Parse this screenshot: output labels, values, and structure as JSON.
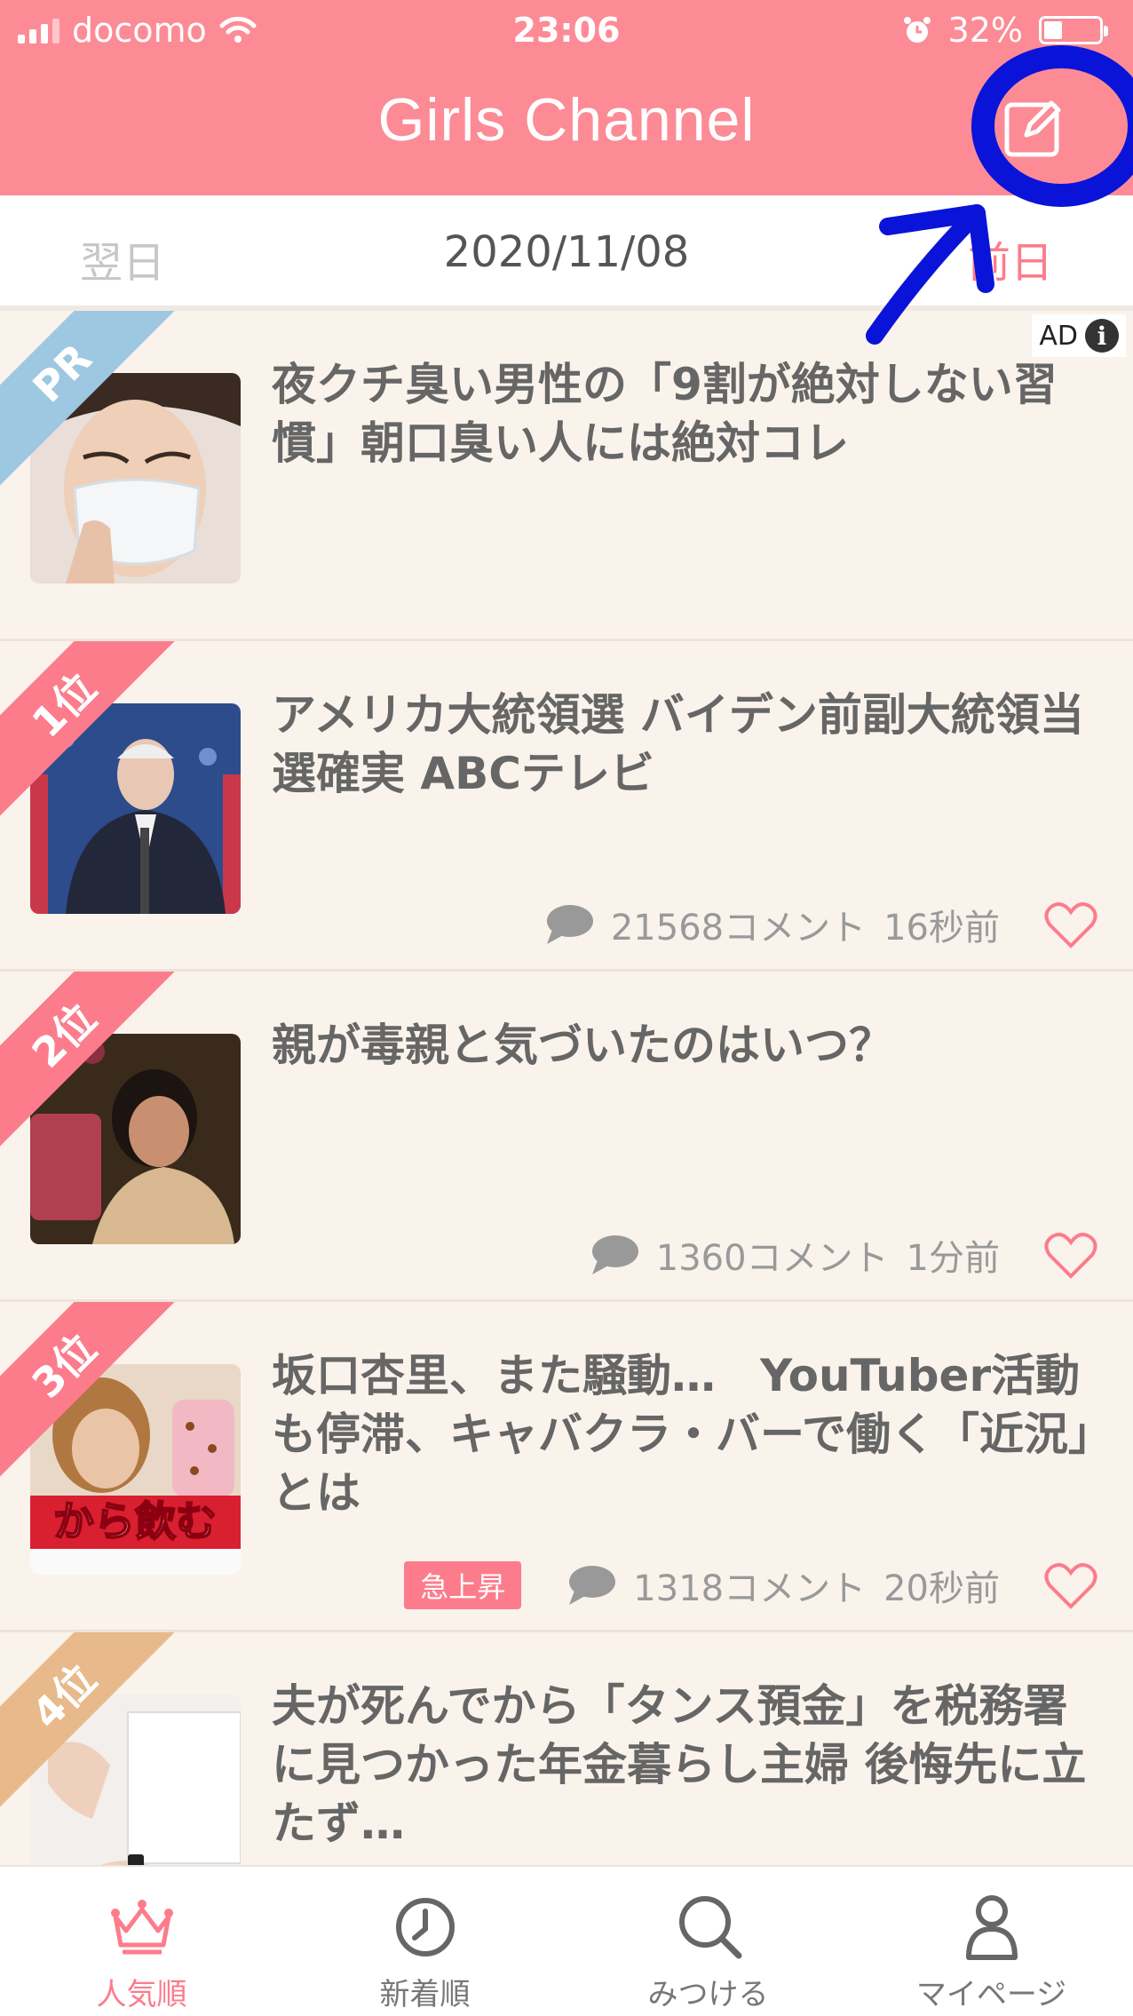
{
  "status_bar": {
    "carrier": "docomo",
    "time": "23:06",
    "battery": "32%"
  },
  "header": {
    "title": "Girls Channel"
  },
  "date_nav": {
    "next_label": "翌日",
    "date": "2020/11/08",
    "prev_label": "前日"
  },
  "ad_label": "AD",
  "items": [
    {
      "rank": "PR",
      "title": "夜クチ臭い男性の「9割が絶対しない習慣」朝口臭い人には絶対コレ"
    },
    {
      "rank": "1位",
      "title": "アメリカ大統領選 バイデン前副大統領当選確実 ABCテレビ",
      "comments": "21568コメント",
      "time": "16秒前"
    },
    {
      "rank": "2位",
      "title": "親が毒親と気づいたのはいつ？",
      "comments": "1360コメント",
      "time": "1分前"
    },
    {
      "rank": "3位",
      "title": "坂口杏里、また騒動…　YouTuber活動も停滞、キャバクラ・バーで働く「近況」とは",
      "badge": "急上昇",
      "comments": "1318コメント",
      "time": "20秒前",
      "thumb_caption": "から飲む"
    },
    {
      "rank": "4位",
      "title": "夫が死んでから「タンス預金」を税務署に見つかった年金暮らし主婦 後悔先に立たず…"
    }
  ],
  "nav": [
    {
      "label": "人気順",
      "icon": "crown-icon",
      "active": true
    },
    {
      "label": "新着順",
      "icon": "clock-icon",
      "active": false
    },
    {
      "label": "みつける",
      "icon": "search-icon",
      "active": false
    },
    {
      "label": "マイページ",
      "icon": "person-icon",
      "active": false
    }
  ],
  "colors": {
    "brand": "#fc8b95",
    "accent": "#fc7c8c",
    "pr_ribbon": "#9ec8e2",
    "rank_ribbon": "#fc7c8c",
    "rank4_ribbon": "#e8b98a",
    "annotation": "#0a14d8"
  }
}
